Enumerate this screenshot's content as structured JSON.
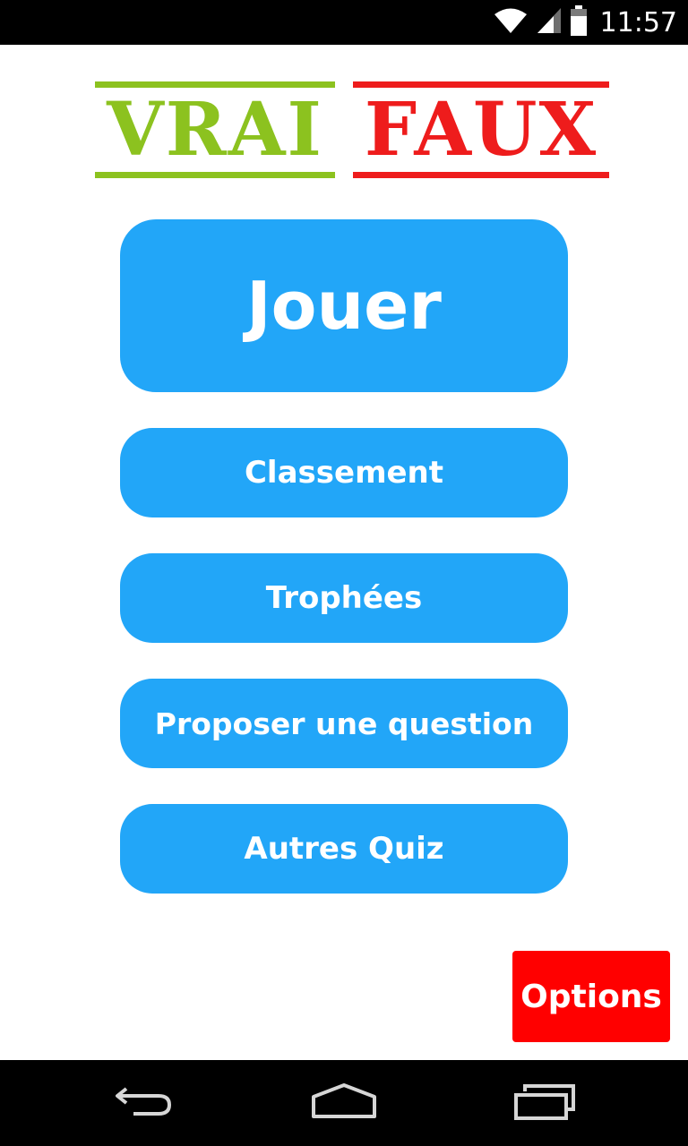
{
  "status_bar": {
    "time": "11:57",
    "icons": [
      "wifi-icon",
      "signal-icon",
      "battery-icon"
    ]
  },
  "logo": {
    "left_word": "VRAI",
    "right_word": "FAUX",
    "left_color": "#8cc21f",
    "right_color": "#ee1c1c"
  },
  "menu": {
    "play_label": "Jouer",
    "ranking_label": "Classement",
    "trophies_label": "Trophées",
    "propose_label": "Proposer une question",
    "other_quiz_label": "Autres Quiz",
    "button_color": "#22a6f8"
  },
  "options": {
    "label": "Options",
    "color": "#ff0000"
  },
  "nav_bar": {
    "icons": [
      "back-icon",
      "home-icon",
      "recents-icon"
    ]
  }
}
